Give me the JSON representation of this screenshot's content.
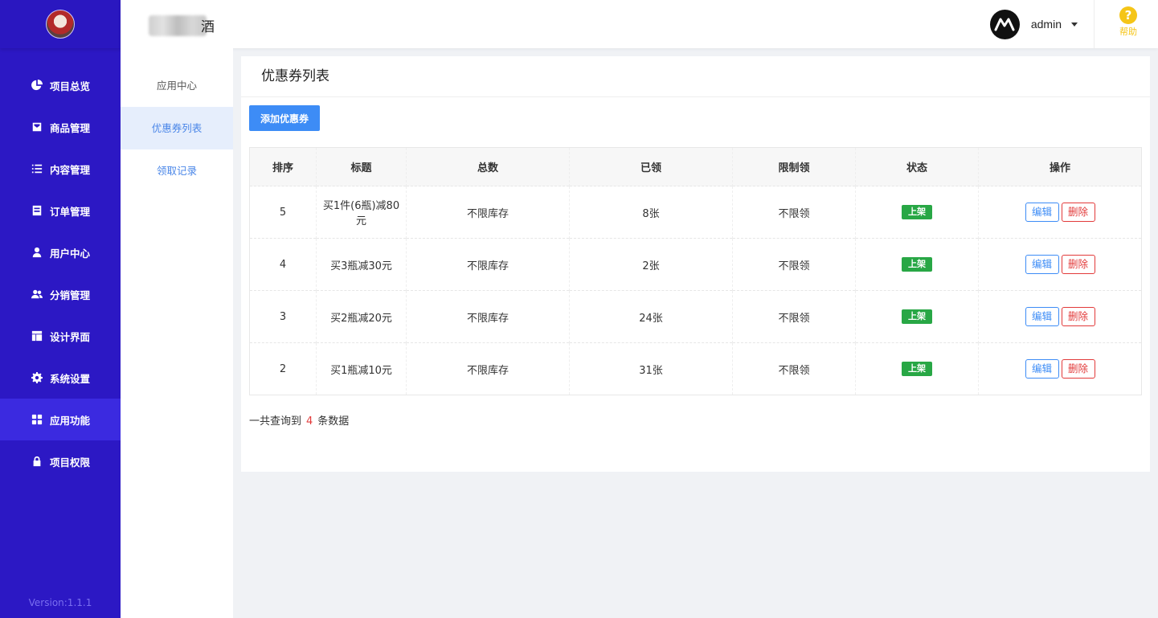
{
  "sidebar": {
    "items": [
      {
        "label": "项目总览",
        "icon": "pie-chart-icon"
      },
      {
        "label": "商品管理",
        "icon": "tag-icon"
      },
      {
        "label": "内容管理",
        "icon": "list-icon"
      },
      {
        "label": "订单管理",
        "icon": "document-icon"
      },
      {
        "label": "用户中心",
        "icon": "user-icon"
      },
      {
        "label": "分销管理",
        "icon": "users-icon"
      },
      {
        "label": "设计界面",
        "icon": "layout-icon"
      },
      {
        "label": "系统设置",
        "icon": "gear-icon"
      },
      {
        "label": "应用功能",
        "icon": "grid-icon"
      },
      {
        "label": "项目权限",
        "icon": "lock-icon"
      }
    ],
    "version": "Version:1.1.1"
  },
  "header": {
    "title_suffix": "酒",
    "username": "admin",
    "help_label": "帮助",
    "help_mark": "?"
  },
  "subnav": {
    "items": [
      {
        "label": "应用中心"
      },
      {
        "label": "优惠券列表"
      },
      {
        "label": "领取记录"
      }
    ]
  },
  "main": {
    "title": "优惠券列表",
    "add_button": "添加优惠券",
    "columns": [
      "排序",
      "标题",
      "总数",
      "已领",
      "限制领",
      "状态",
      "操作"
    ],
    "rows": [
      {
        "sort": "5",
        "title": "买1件(6瓶)减80元",
        "total": "不限库存",
        "claimed": "8张",
        "limit": "不限领",
        "status": "上架",
        "edit": "编辑",
        "delete": "删除"
      },
      {
        "sort": "4",
        "title": "买3瓶减30元",
        "total": "不限库存",
        "claimed": "2张",
        "limit": "不限领",
        "status": "上架",
        "edit": "编辑",
        "delete": "删除"
      },
      {
        "sort": "3",
        "title": "买2瓶减20元",
        "total": "不限库存",
        "claimed": "24张",
        "limit": "不限领",
        "status": "上架",
        "edit": "编辑",
        "delete": "删除"
      },
      {
        "sort": "2",
        "title": "买1瓶减10元",
        "total": "不限库存",
        "claimed": "31张",
        "limit": "不限领",
        "status": "上架",
        "edit": "编辑",
        "delete": "删除"
      }
    ],
    "summary_prefix": "一共查询到",
    "summary_count": "4",
    "summary_suffix": "条数据"
  },
  "colors": {
    "sidebar_bg": "#2c18c4",
    "primary": "#3d8cf6",
    "success": "#28a745",
    "danger": "#e23a3a",
    "help": "#f5c518"
  }
}
